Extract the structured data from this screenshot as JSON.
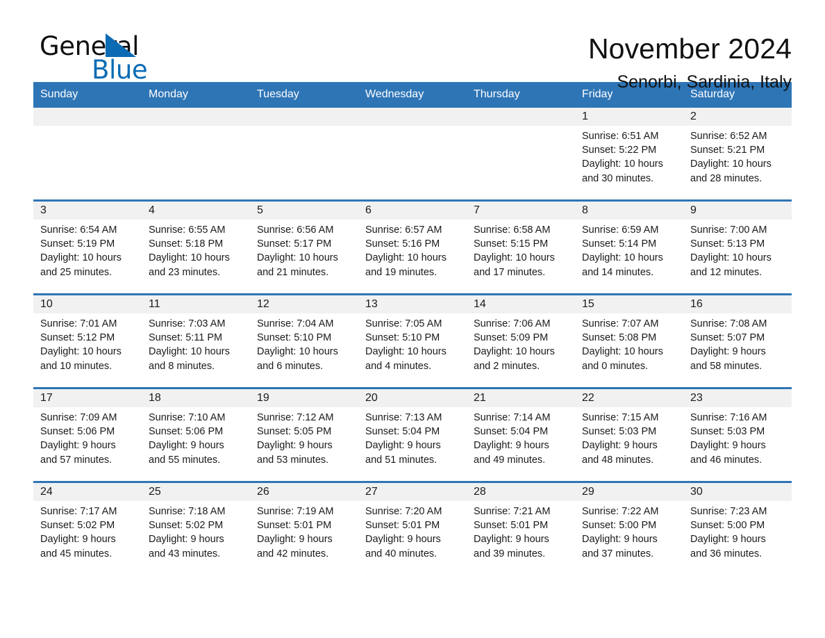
{
  "brand": {
    "name_part1": "General",
    "name_part2": "Blue",
    "accent_color": "#0b6cb4",
    "flag_icon": "triangle-flag-icon"
  },
  "header": {
    "month_title": "November 2024",
    "location": "Senorbi, Sardinia, Italy"
  },
  "calendar": {
    "header_bg": "#2e75b6",
    "day_band_bg": "#f1f1f1",
    "weekdays": [
      "Sunday",
      "Monday",
      "Tuesday",
      "Wednesday",
      "Thursday",
      "Friday",
      "Saturday"
    ],
    "weeks": [
      [
        {
          "day": "",
          "lines": []
        },
        {
          "day": "",
          "lines": []
        },
        {
          "day": "",
          "lines": []
        },
        {
          "day": "",
          "lines": []
        },
        {
          "day": "",
          "lines": []
        },
        {
          "day": "1",
          "lines": [
            "Sunrise: 6:51 AM",
            "Sunset: 5:22 PM",
            "Daylight: 10 hours",
            "and 30 minutes."
          ]
        },
        {
          "day": "2",
          "lines": [
            "Sunrise: 6:52 AM",
            "Sunset: 5:21 PM",
            "Daylight: 10 hours",
            "and 28 minutes."
          ]
        }
      ],
      [
        {
          "day": "3",
          "lines": [
            "Sunrise: 6:54 AM",
            "Sunset: 5:19 PM",
            "Daylight: 10 hours",
            "and 25 minutes."
          ]
        },
        {
          "day": "4",
          "lines": [
            "Sunrise: 6:55 AM",
            "Sunset: 5:18 PM",
            "Daylight: 10 hours",
            "and 23 minutes."
          ]
        },
        {
          "day": "5",
          "lines": [
            "Sunrise: 6:56 AM",
            "Sunset: 5:17 PM",
            "Daylight: 10 hours",
            "and 21 minutes."
          ]
        },
        {
          "day": "6",
          "lines": [
            "Sunrise: 6:57 AM",
            "Sunset: 5:16 PM",
            "Daylight: 10 hours",
            "and 19 minutes."
          ]
        },
        {
          "day": "7",
          "lines": [
            "Sunrise: 6:58 AM",
            "Sunset: 5:15 PM",
            "Daylight: 10 hours",
            "and 17 minutes."
          ]
        },
        {
          "day": "8",
          "lines": [
            "Sunrise: 6:59 AM",
            "Sunset: 5:14 PM",
            "Daylight: 10 hours",
            "and 14 minutes."
          ]
        },
        {
          "day": "9",
          "lines": [
            "Sunrise: 7:00 AM",
            "Sunset: 5:13 PM",
            "Daylight: 10 hours",
            "and 12 minutes."
          ]
        }
      ],
      [
        {
          "day": "10",
          "lines": [
            "Sunrise: 7:01 AM",
            "Sunset: 5:12 PM",
            "Daylight: 10 hours",
            "and 10 minutes."
          ]
        },
        {
          "day": "11",
          "lines": [
            "Sunrise: 7:03 AM",
            "Sunset: 5:11 PM",
            "Daylight: 10 hours",
            "and 8 minutes."
          ]
        },
        {
          "day": "12",
          "lines": [
            "Sunrise: 7:04 AM",
            "Sunset: 5:10 PM",
            "Daylight: 10 hours",
            "and 6 minutes."
          ]
        },
        {
          "day": "13",
          "lines": [
            "Sunrise: 7:05 AM",
            "Sunset: 5:10 PM",
            "Daylight: 10 hours",
            "and 4 minutes."
          ]
        },
        {
          "day": "14",
          "lines": [
            "Sunrise: 7:06 AM",
            "Sunset: 5:09 PM",
            "Daylight: 10 hours",
            "and 2 minutes."
          ]
        },
        {
          "day": "15",
          "lines": [
            "Sunrise: 7:07 AM",
            "Sunset: 5:08 PM",
            "Daylight: 10 hours",
            "and 0 minutes."
          ]
        },
        {
          "day": "16",
          "lines": [
            "Sunrise: 7:08 AM",
            "Sunset: 5:07 PM",
            "Daylight: 9 hours",
            "and 58 minutes."
          ]
        }
      ],
      [
        {
          "day": "17",
          "lines": [
            "Sunrise: 7:09 AM",
            "Sunset: 5:06 PM",
            "Daylight: 9 hours",
            "and 57 minutes."
          ]
        },
        {
          "day": "18",
          "lines": [
            "Sunrise: 7:10 AM",
            "Sunset: 5:06 PM",
            "Daylight: 9 hours",
            "and 55 minutes."
          ]
        },
        {
          "day": "19",
          "lines": [
            "Sunrise: 7:12 AM",
            "Sunset: 5:05 PM",
            "Daylight: 9 hours",
            "and 53 minutes."
          ]
        },
        {
          "day": "20",
          "lines": [
            "Sunrise: 7:13 AM",
            "Sunset: 5:04 PM",
            "Daylight: 9 hours",
            "and 51 minutes."
          ]
        },
        {
          "day": "21",
          "lines": [
            "Sunrise: 7:14 AM",
            "Sunset: 5:04 PM",
            "Daylight: 9 hours",
            "and 49 minutes."
          ]
        },
        {
          "day": "22",
          "lines": [
            "Sunrise: 7:15 AM",
            "Sunset: 5:03 PM",
            "Daylight: 9 hours",
            "and 48 minutes."
          ]
        },
        {
          "day": "23",
          "lines": [
            "Sunrise: 7:16 AM",
            "Sunset: 5:03 PM",
            "Daylight: 9 hours",
            "and 46 minutes."
          ]
        }
      ],
      [
        {
          "day": "24",
          "lines": [
            "Sunrise: 7:17 AM",
            "Sunset: 5:02 PM",
            "Daylight: 9 hours",
            "and 45 minutes."
          ]
        },
        {
          "day": "25",
          "lines": [
            "Sunrise: 7:18 AM",
            "Sunset: 5:02 PM",
            "Daylight: 9 hours",
            "and 43 minutes."
          ]
        },
        {
          "day": "26",
          "lines": [
            "Sunrise: 7:19 AM",
            "Sunset: 5:01 PM",
            "Daylight: 9 hours",
            "and 42 minutes."
          ]
        },
        {
          "day": "27",
          "lines": [
            "Sunrise: 7:20 AM",
            "Sunset: 5:01 PM",
            "Daylight: 9 hours",
            "and 40 minutes."
          ]
        },
        {
          "day": "28",
          "lines": [
            "Sunrise: 7:21 AM",
            "Sunset: 5:01 PM",
            "Daylight: 9 hours",
            "and 39 minutes."
          ]
        },
        {
          "day": "29",
          "lines": [
            "Sunrise: 7:22 AM",
            "Sunset: 5:00 PM",
            "Daylight: 9 hours",
            "and 37 minutes."
          ]
        },
        {
          "day": "30",
          "lines": [
            "Sunrise: 7:23 AM",
            "Sunset: 5:00 PM",
            "Daylight: 9 hours",
            "and 36 minutes."
          ]
        }
      ]
    ]
  }
}
